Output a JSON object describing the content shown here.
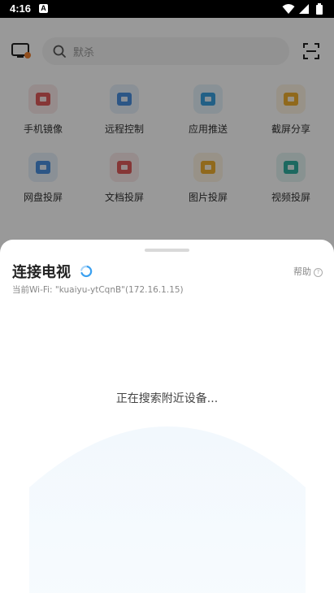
{
  "status_bar": {
    "time": "4:16",
    "notification_badge": "A",
    "icons": [
      "wifi-icon",
      "signal-icon",
      "battery-icon"
    ]
  },
  "app": {
    "search": {
      "placeholder": "默杀",
      "icon": "search-icon"
    },
    "left_icon": "tv-icon",
    "right_icon": "scan-icon",
    "features": [
      {
        "label": "手机镜像",
        "icon": "phone-mirror-icon",
        "color": "#e05a5a"
      },
      {
        "label": "远程控制",
        "icon": "remote-control-icon",
        "color": "#4a8fe0"
      },
      {
        "label": "应用推送",
        "icon": "app-push-icon",
        "color": "#3aa0e0"
      },
      {
        "label": "截屏分享",
        "icon": "screenshot-share-icon",
        "color": "#f0b030"
      },
      {
        "label": "网盘投屏",
        "icon": "cloud-cast-icon",
        "color": "#4a8fe0"
      },
      {
        "label": "文档投屏",
        "icon": "doc-cast-icon",
        "color": "#e05a5a"
      },
      {
        "label": "图片投屏",
        "icon": "image-cast-icon",
        "color": "#f0b030"
      },
      {
        "label": "视频投屏",
        "icon": "video-cast-icon",
        "color": "#30b0a0"
      }
    ]
  },
  "sheet": {
    "title": "连接电视",
    "help": "帮助",
    "help_icon": "?",
    "wifi_info": "当前Wi-Fi: \"kuaiyu-ytCqnB\"(172.16.1.15)",
    "searching_text": "正在搜索附近设备...",
    "accent_color": "#3aa0f0"
  }
}
